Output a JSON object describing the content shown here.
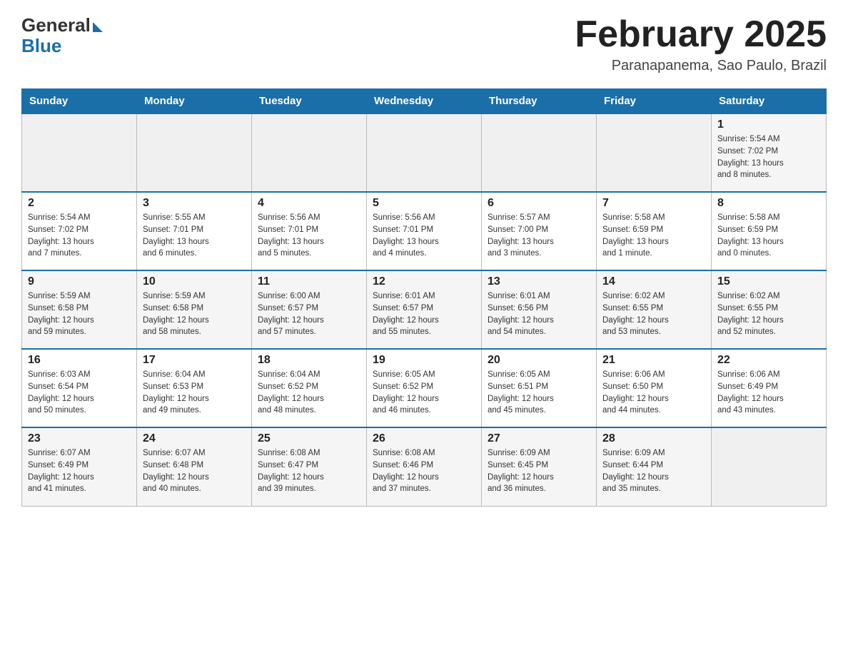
{
  "header": {
    "logo_general": "General",
    "logo_blue": "Blue",
    "main_title": "February 2025",
    "subtitle": "Paranapanema, Sao Paulo, Brazil"
  },
  "weekdays": [
    "Sunday",
    "Monday",
    "Tuesday",
    "Wednesday",
    "Thursday",
    "Friday",
    "Saturday"
  ],
  "weeks": [
    [
      {
        "day": "",
        "info": ""
      },
      {
        "day": "",
        "info": ""
      },
      {
        "day": "",
        "info": ""
      },
      {
        "day": "",
        "info": ""
      },
      {
        "day": "",
        "info": ""
      },
      {
        "day": "",
        "info": ""
      },
      {
        "day": "1",
        "info": "Sunrise: 5:54 AM\nSunset: 7:02 PM\nDaylight: 13 hours\nand 8 minutes."
      }
    ],
    [
      {
        "day": "2",
        "info": "Sunrise: 5:54 AM\nSunset: 7:02 PM\nDaylight: 13 hours\nand 7 minutes."
      },
      {
        "day": "3",
        "info": "Sunrise: 5:55 AM\nSunset: 7:01 PM\nDaylight: 13 hours\nand 6 minutes."
      },
      {
        "day": "4",
        "info": "Sunrise: 5:56 AM\nSunset: 7:01 PM\nDaylight: 13 hours\nand 5 minutes."
      },
      {
        "day": "5",
        "info": "Sunrise: 5:56 AM\nSunset: 7:01 PM\nDaylight: 13 hours\nand 4 minutes."
      },
      {
        "day": "6",
        "info": "Sunrise: 5:57 AM\nSunset: 7:00 PM\nDaylight: 13 hours\nand 3 minutes."
      },
      {
        "day": "7",
        "info": "Sunrise: 5:58 AM\nSunset: 6:59 PM\nDaylight: 13 hours\nand 1 minute."
      },
      {
        "day": "8",
        "info": "Sunrise: 5:58 AM\nSunset: 6:59 PM\nDaylight: 13 hours\nand 0 minutes."
      }
    ],
    [
      {
        "day": "9",
        "info": "Sunrise: 5:59 AM\nSunset: 6:58 PM\nDaylight: 12 hours\nand 59 minutes."
      },
      {
        "day": "10",
        "info": "Sunrise: 5:59 AM\nSunset: 6:58 PM\nDaylight: 12 hours\nand 58 minutes."
      },
      {
        "day": "11",
        "info": "Sunrise: 6:00 AM\nSunset: 6:57 PM\nDaylight: 12 hours\nand 57 minutes."
      },
      {
        "day": "12",
        "info": "Sunrise: 6:01 AM\nSunset: 6:57 PM\nDaylight: 12 hours\nand 55 minutes."
      },
      {
        "day": "13",
        "info": "Sunrise: 6:01 AM\nSunset: 6:56 PM\nDaylight: 12 hours\nand 54 minutes."
      },
      {
        "day": "14",
        "info": "Sunrise: 6:02 AM\nSunset: 6:55 PM\nDaylight: 12 hours\nand 53 minutes."
      },
      {
        "day": "15",
        "info": "Sunrise: 6:02 AM\nSunset: 6:55 PM\nDaylight: 12 hours\nand 52 minutes."
      }
    ],
    [
      {
        "day": "16",
        "info": "Sunrise: 6:03 AM\nSunset: 6:54 PM\nDaylight: 12 hours\nand 50 minutes."
      },
      {
        "day": "17",
        "info": "Sunrise: 6:04 AM\nSunset: 6:53 PM\nDaylight: 12 hours\nand 49 minutes."
      },
      {
        "day": "18",
        "info": "Sunrise: 6:04 AM\nSunset: 6:52 PM\nDaylight: 12 hours\nand 48 minutes."
      },
      {
        "day": "19",
        "info": "Sunrise: 6:05 AM\nSunset: 6:52 PM\nDaylight: 12 hours\nand 46 minutes."
      },
      {
        "day": "20",
        "info": "Sunrise: 6:05 AM\nSunset: 6:51 PM\nDaylight: 12 hours\nand 45 minutes."
      },
      {
        "day": "21",
        "info": "Sunrise: 6:06 AM\nSunset: 6:50 PM\nDaylight: 12 hours\nand 44 minutes."
      },
      {
        "day": "22",
        "info": "Sunrise: 6:06 AM\nSunset: 6:49 PM\nDaylight: 12 hours\nand 43 minutes."
      }
    ],
    [
      {
        "day": "23",
        "info": "Sunrise: 6:07 AM\nSunset: 6:49 PM\nDaylight: 12 hours\nand 41 minutes."
      },
      {
        "day": "24",
        "info": "Sunrise: 6:07 AM\nSunset: 6:48 PM\nDaylight: 12 hours\nand 40 minutes."
      },
      {
        "day": "25",
        "info": "Sunrise: 6:08 AM\nSunset: 6:47 PM\nDaylight: 12 hours\nand 39 minutes."
      },
      {
        "day": "26",
        "info": "Sunrise: 6:08 AM\nSunset: 6:46 PM\nDaylight: 12 hours\nand 37 minutes."
      },
      {
        "day": "27",
        "info": "Sunrise: 6:09 AM\nSunset: 6:45 PM\nDaylight: 12 hours\nand 36 minutes."
      },
      {
        "day": "28",
        "info": "Sunrise: 6:09 AM\nSunset: 6:44 PM\nDaylight: 12 hours\nand 35 minutes."
      },
      {
        "day": "",
        "info": ""
      }
    ]
  ]
}
